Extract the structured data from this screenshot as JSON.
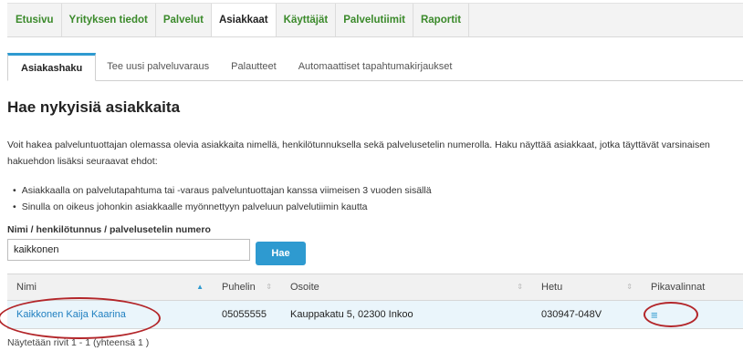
{
  "main_nav": {
    "items": [
      {
        "label": "Etusivu",
        "active": false
      },
      {
        "label": "Yrityksen tiedot",
        "active": false
      },
      {
        "label": "Palvelut",
        "active": false
      },
      {
        "label": "Asiakkaat",
        "active": true
      },
      {
        "label": "Käyttäjät",
        "active": false
      },
      {
        "label": "Palvelutiimit",
        "active": false
      },
      {
        "label": "Raportit",
        "active": false
      }
    ]
  },
  "sub_tabs": {
    "items": [
      {
        "label": "Asiakashaku",
        "active": true
      },
      {
        "label": "Tee uusi palveluvaraus",
        "active": false
      },
      {
        "label": "Palautteet",
        "active": false
      },
      {
        "label": "Automaattiset tapahtumakirjaukset",
        "active": false
      }
    ]
  },
  "page": {
    "title": "Hae nykyisiä asiakkaita",
    "intro": "Voit hakea palveluntuottajan olemassa olevia asiakkaita nimellä, henkilötunnuksella sekä palvelusetelin numerolla. Haku näyttää asiakkaat, jotka täyttävät varsinaisen hakuehdon lisäksi seuraavat ehdot:",
    "conditions": [
      "Asiakkaalla on palvelutapahtuma tai -varaus palveluntuottajan kanssa viimeisen 3 vuoden sisällä",
      "Sinulla on oikeus johonkin asiakkaalle myönnettyyn palveluun palvelutiimin kautta"
    ]
  },
  "search": {
    "label": "Nimi / henkilötunnus / palvelusetelin numero",
    "value": "kaikkonen",
    "button_label": "Hae"
  },
  "table": {
    "columns": {
      "name": "Nimi",
      "phone": "Puhelin",
      "address": "Osoite",
      "ssn": "Hetu",
      "quick_links": "Pikavalinnat"
    },
    "rows": [
      {
        "name": "Kaikkonen Kaija Kaarina",
        "phone": "05055555",
        "address": "Kauppakatu 5, 02300 Inkoo",
        "ssn": "030947-048V",
        "quick_links_icon": "≡"
      }
    ]
  },
  "footer": {
    "summary": "Näytetään rivit 1 - 1 (yhteensä 1 )"
  },
  "colors": {
    "nav_green": "#3b8a2b",
    "accent_blue": "#2e9ad0",
    "link_blue": "#1f7fc0",
    "row_highlight": "#eaf5fb",
    "annotation_red": "#b3262a"
  }
}
